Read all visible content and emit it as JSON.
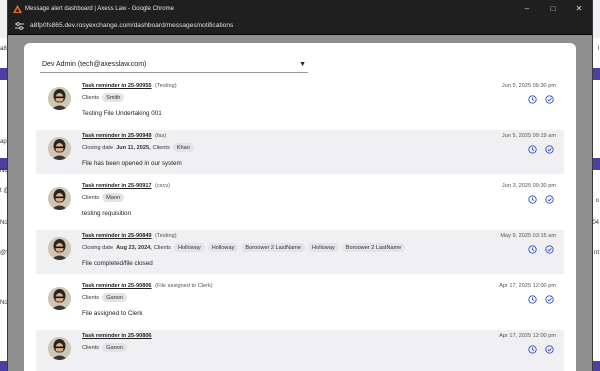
{
  "window": {
    "title": "Message alert dashboard | Axess Law - Google Chrome",
    "url": "a8fp0fs865.dev.rosyexchange.com/dashboard/messages/notifications"
  },
  "background": {
    "left_texts": [
      "a8",
      "ap",
      "No",
      "t @",
      "No",
      "@S",
      "No"
    ],
    "right_texts": [
      "l",
      "o",
      "04",
      "nt"
    ]
  },
  "selector": {
    "value": "Dev Admin (tech@axesslaw.com)"
  },
  "accent_color": "#2f4fbf",
  "notifications": [
    {
      "link": "Task reminder in 25-90955",
      "tag": "(Testing)",
      "date": "Jun 5, 2025 06:30 pm",
      "closing_label": "",
      "closing_date": "",
      "clients_label": "Clients",
      "clients": [
        "Smith"
      ],
      "message": "Testing File Undertaking 001"
    },
    {
      "link": "Task reminder in 25-90949",
      "tag": "(fas)",
      "date": "Jun 5, 2025 09:19 am",
      "closing_label": "Closing date",
      "closing_date": "Jun 11, 2025,",
      "clients_label": "Clients",
      "clients": [
        "Khan"
      ],
      "message": "File has been opened in our system"
    },
    {
      "link": "Task reminder in 25-90917",
      "tag": "(cscv)",
      "date": "Jun 3, 2025 09:30 pm",
      "closing_label": "",
      "closing_date": "",
      "clients_label": "Clients",
      "clients": [
        "Mann"
      ],
      "message": "testing requisition"
    },
    {
      "link": "Task reminder in 25-90849",
      "tag": "(Testing)",
      "date": "May 9, 2025 03:15 am",
      "closing_label": "Closing date",
      "closing_date": "Aug 23, 2024,",
      "clients_label": "Clients",
      "clients": [
        "Holloway",
        "Holloway",
        "Boroower 2 LastName",
        "Holloway",
        "Boroower 2 LastName"
      ],
      "message": "File completed/file closed"
    },
    {
      "link": "Task reminder in 25-90806",
      "tag": "(File assigned to Clerk)",
      "date": "Apr 17, 2025 12:00 pm",
      "closing_label": "",
      "closing_date": "",
      "clients_label": "Clients",
      "clients": [
        "Ganon"
      ],
      "message": "File assigned to Clerk"
    },
    {
      "link": "Task reminder in 25-90806",
      "tag": "",
      "date": "Apr 17, 2025 12:00 pm",
      "closing_label": "",
      "closing_date": "",
      "clients_label": "Clients",
      "clients": [
        "Ganon"
      ],
      "message": ""
    }
  ]
}
